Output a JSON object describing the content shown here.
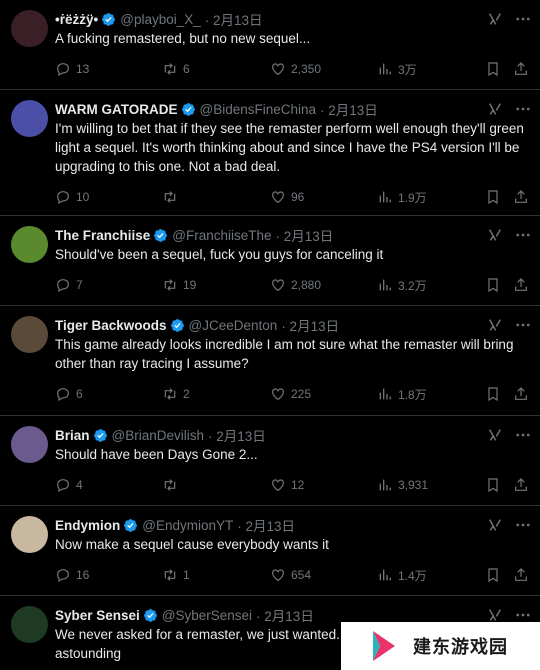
{
  "tweets": [
    {
      "name": "•ṙëżżÿ•",
      "handle": "@playboi_X_",
      "time": "· 2月13日",
      "text": "A fucking remastered, but no new sequel...",
      "replies": "13",
      "retweets": "6",
      "likes": "2,350",
      "views": "3万",
      "avatar_color": "#3a1f26"
    },
    {
      "name": "WARM GATORADE",
      "handle": "@BidensFineChina",
      "time": "· 2月13日",
      "text": "I'm willing to bet that if they see the remaster perform well enough they'll green light a sequel. It's worth thinking about and since I have the PS4 version I'll be upgrading to this one. Not a bad deal.",
      "replies": "10",
      "retweets": "",
      "likes": "96",
      "views": "1.9万",
      "avatar_color": "#4b4fa8"
    },
    {
      "name": "The Franchiise",
      "handle": "@FranchiiseThe",
      "time": "· 2月13日",
      "text": "Should've been a sequel, fuck you guys for canceling it",
      "replies": "7",
      "retweets": "19",
      "likes": "2,880",
      "views": "3.2万",
      "avatar_color": "#5b8a2e"
    },
    {
      "name": "Tiger Backwoods",
      "handle": "@JCeeDenton",
      "time": "· 2月13日",
      "text": "This game already looks incredible I am not sure what the remaster will bring other than ray tracing I assume?",
      "replies": "6",
      "retweets": "2",
      "likes": "225",
      "views": "1.8万",
      "avatar_color": "#5a4a3a"
    },
    {
      "name": "Brian",
      "handle": "@BrianDevilish",
      "time": "· 2月13日",
      "text": "Should have been Days Gone 2...",
      "replies": "4",
      "retweets": "",
      "likes": "12",
      "views": "3,931",
      "avatar_color": "#6b5a8e"
    },
    {
      "name": "Endymion",
      "handle": "@EndymionYT",
      "time": "· 2月13日",
      "text": "Now make a sequel cause everybody wants it",
      "replies": "16",
      "retweets": "1",
      "likes": "654",
      "views": "1.4万",
      "avatar_color": "#c8b8a0"
    },
    {
      "name": "Syber Sensei",
      "handle": "@SyberSensei",
      "time": "· 2月13日",
      "text": "We never asked for a remaster, we just wanted... touch with gamers it's astounding",
      "replies": "",
      "retweets": "",
      "likes": "",
      "views": "",
      "avatar_color": "#1e3a22"
    }
  ],
  "watermark": {
    "text": "建东游戏园"
  },
  "colors": {
    "verified": "#1d9bf0",
    "muted": "#71767b",
    "divider": "#2f3336"
  }
}
